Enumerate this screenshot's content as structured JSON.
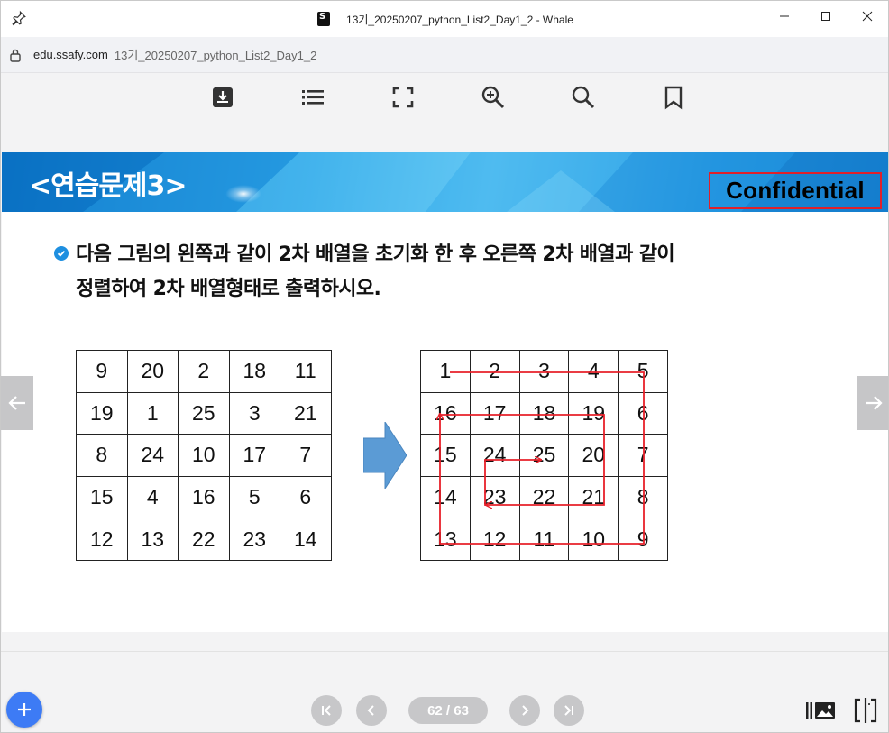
{
  "window": {
    "title": "13기_20250207_python_List2_Day1_2 - Whale"
  },
  "address": {
    "domain": "edu.ssafy.com",
    "path": "13기_20250207_python_List2_Day1_2"
  },
  "toolbar": {
    "icons": [
      "download-icon",
      "list-icon",
      "fullscreen-icon",
      "zoom-in-icon",
      "search-icon",
      "bookmark-icon"
    ]
  },
  "slide": {
    "title": "<연습문제3>",
    "confidential": "Confidential",
    "question_line1": "다음 그림의 왼쪽과 같이 2차 배열을 초기화 한 후 오른쪽 2차 배열과 같이",
    "question_line2": "정렬하여 2차 배열형태로 출력하시오.",
    "left_grid": [
      [
        "9",
        "20",
        "2",
        "18",
        "11"
      ],
      [
        "19",
        "1",
        "25",
        "3",
        "21"
      ],
      [
        "8",
        "24",
        "10",
        "17",
        "7"
      ],
      [
        "15",
        "4",
        "16",
        "5",
        "6"
      ],
      [
        "12",
        "13",
        "22",
        "23",
        "14"
      ]
    ],
    "right_grid": [
      [
        "1",
        "2",
        "3",
        "4",
        "5"
      ],
      [
        "16",
        "17",
        "18",
        "19",
        "6"
      ],
      [
        "15",
        "24",
        "25",
        "20",
        "7"
      ],
      [
        "14",
        "23",
        "22",
        "21",
        "8"
      ],
      [
        "13",
        "12",
        "11",
        "10",
        "9"
      ]
    ],
    "spiral_color": "#e8202a",
    "arrow_color": "#5b9bd5"
  },
  "pagination": {
    "indicator": "62 / 63"
  },
  "colors": {
    "header_blue": "#2ba4e8",
    "fab_blue": "#3d7bf5",
    "confidential_border": "#e0202a"
  }
}
